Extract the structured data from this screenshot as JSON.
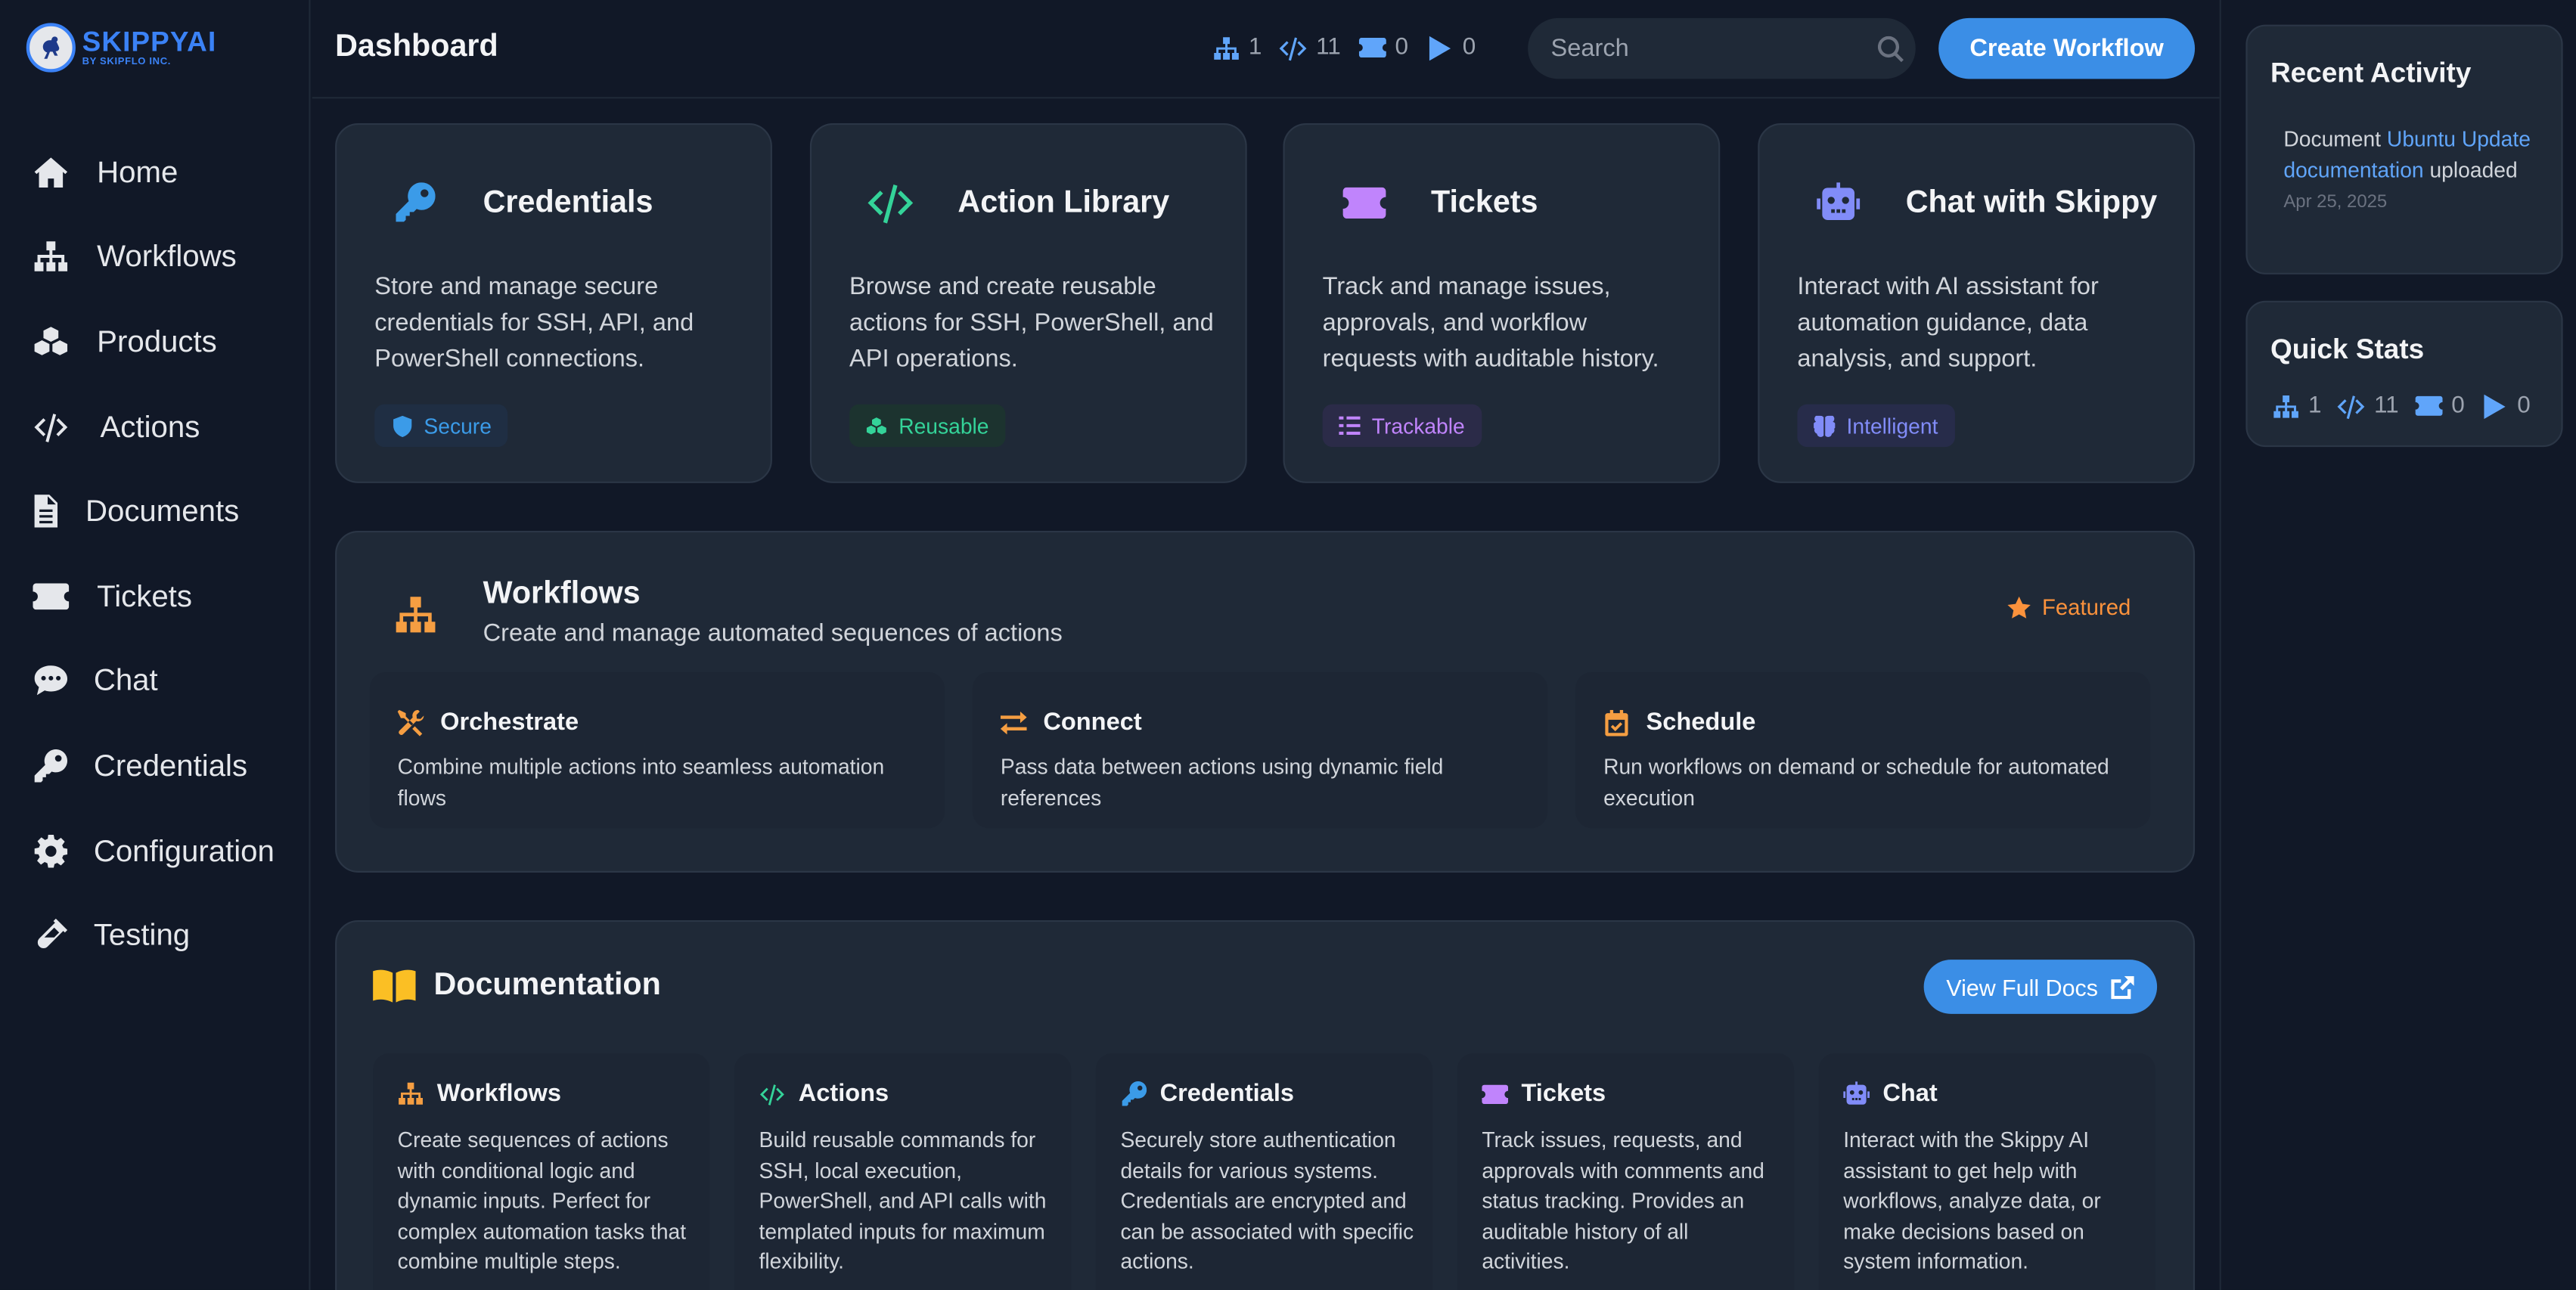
{
  "app": {
    "brand_name": "SKIPPYAI",
    "brand_sub": "BY SKIPFLO INC."
  },
  "sidebar": {
    "items": [
      {
        "label": "Home",
        "icon": "home-icon"
      },
      {
        "label": "Workflows",
        "icon": "sitemap-icon"
      },
      {
        "label": "Products",
        "icon": "cubes-icon"
      },
      {
        "label": "Actions",
        "icon": "code-icon"
      },
      {
        "label": "Documents",
        "icon": "document-icon"
      },
      {
        "label": "Tickets",
        "icon": "ticket-icon"
      },
      {
        "label": "Chat",
        "icon": "chat-icon"
      },
      {
        "label": "Credentials",
        "icon": "key-icon"
      },
      {
        "label": "Configuration",
        "icon": "gear-icon"
      },
      {
        "label": "Testing",
        "icon": "flask-icon"
      }
    ]
  },
  "header": {
    "title": "Dashboard",
    "stats": {
      "workflows": "1",
      "actions": "11",
      "tickets": "0",
      "runs": "0"
    },
    "search_placeholder": "Search",
    "create_label": "Create Workflow"
  },
  "cards": [
    {
      "title": "Credentials",
      "desc": "Store and manage secure credentials for SSH, API, and PowerShell connections.",
      "badge": "Secure",
      "icon": "key-icon",
      "badge_icon": "shield-icon",
      "color": "#3b9be8"
    },
    {
      "title": "Action Library",
      "desc": "Browse and create reusable actions for SSH, PowerShell, and API operations.",
      "badge": "Reusable",
      "icon": "code-icon",
      "badge_icon": "cubes-icon",
      "color": "#34d399"
    },
    {
      "title": "Tickets",
      "desc": "Track and manage issues, approvals, and workflow requests with auditable history.",
      "badge": "Trackable",
      "icon": "ticket-icon",
      "badge_icon": "list-icon",
      "color": "#c084fc"
    },
    {
      "title": "Chat with Skippy",
      "desc": "Interact with AI assistant for automation guidance, data analysis, and support.",
      "badge": "Intelligent",
      "icon": "robot-icon",
      "badge_icon": "brain-icon",
      "color": "#818cf8"
    }
  ],
  "workflows_panel": {
    "title": "Workflows",
    "subtitle": "Create and manage automated sequences of actions",
    "featured_label": "Featured",
    "features": [
      {
        "title": "Orchestrate",
        "desc": "Combine multiple actions into seamless automation flows",
        "icon": "tools-icon"
      },
      {
        "title": "Connect",
        "desc": "Pass data between actions using dynamic field references",
        "icon": "exchange-icon"
      },
      {
        "title": "Schedule",
        "desc": "Run workflows on demand or schedule for automated execution",
        "icon": "calendar-icon"
      }
    ]
  },
  "docs_panel": {
    "title": "Documentation",
    "view_label": "View Full Docs",
    "columns": [
      {
        "title": "Workflows",
        "desc": "Create sequences of actions with conditional logic and dynamic inputs. Perfect for complex automation tasks that combine multiple steps.",
        "icon": "sitemap-icon",
        "color": "#f59e42"
      },
      {
        "title": "Actions",
        "desc": "Build reusable commands for SSH, local execution, PowerShell, and API calls with templated inputs for maximum flexibility.",
        "icon": "code-icon",
        "color": "#34d399"
      },
      {
        "title": "Credentials",
        "desc": "Securely store authentication details for various systems. Credentials are encrypted and can be associated with specific actions.",
        "icon": "key-icon",
        "color": "#3b9be8"
      },
      {
        "title": "Tickets",
        "desc": "Track issues, requests, and approvals with comments and status tracking. Provides an auditable history of all activities.",
        "icon": "ticket-icon",
        "color": "#c084fc"
      },
      {
        "title": "Chat",
        "desc": "Interact with the Skippy AI assistant to get help with workflows, analyze data, or make decisions based on system information.",
        "icon": "robot-icon",
        "color": "#818cf8"
      }
    ]
  },
  "recent_activity": {
    "title": "Recent Activity",
    "prefix": "Document",
    "doc_link": "Ubuntu Update documentation",
    "suffix": "uploaded",
    "date": "Apr 25, 2025"
  },
  "quick_stats": {
    "title": "Quick Stats",
    "workflows": "1",
    "actions": "11",
    "tickets": "0",
    "runs": "0"
  },
  "colors": {
    "accent": "#3b8ee6",
    "background": "#111827",
    "card": "#1f2937"
  }
}
